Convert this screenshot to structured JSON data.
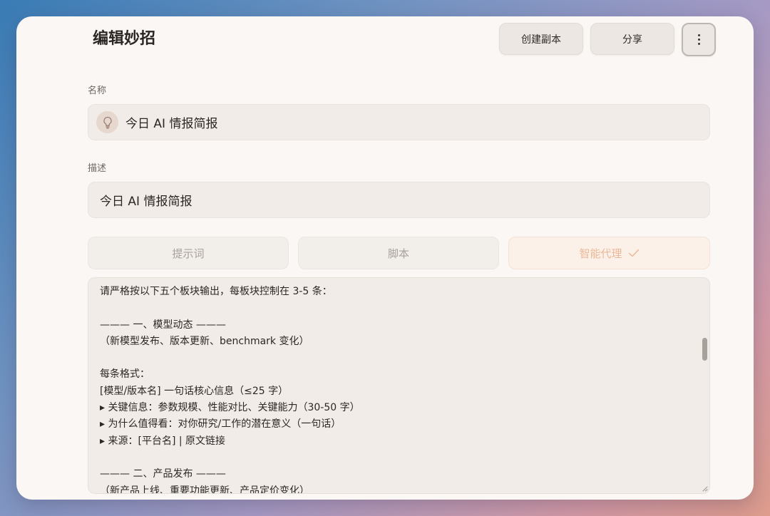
{
  "header": {
    "title": "编辑妙招",
    "copy_label": "创建副本",
    "share_label": "分享"
  },
  "form": {
    "name_label": "名称",
    "name_value": "今日 AI 情报简报",
    "description_label": "描述",
    "description_value": "今日 AI 情报简报"
  },
  "tabs": {
    "prompt": "提示词",
    "script": "脚本",
    "agent": "智能代理",
    "selected": "agent"
  },
  "editor": {
    "lines": [
      "请严格按以下五个板块输出，每板块控制在 3-5 条：",
      "",
      "——— 一、模型动态 ———",
      "（新模型发布、版本更新、benchmark 变化）",
      "",
      "每条格式：",
      "[模型/版本名] 一句话核心信息（≤25 字）",
      "▸ 关键信息：参数规模、性能对比、关键能力（30-50 字）",
      "▸ 为什么值得看：对你研究/工作的潜在意义（一句话）",
      "▸ 来源：[平台名] | 原文链接",
      "",
      "——— 二、产品发布 ———",
      "（新产品上线、重要功能更新、产品定价变化）"
    ]
  },
  "icons": {
    "more": "more-vertical-icon",
    "name": "lightbulb-icon",
    "agent_check": "check-icon"
  },
  "colors": {
    "window_bg": "#fbf7f4",
    "field_bg": "#f1ece8",
    "accent_tab_text": "#e9b898"
  }
}
